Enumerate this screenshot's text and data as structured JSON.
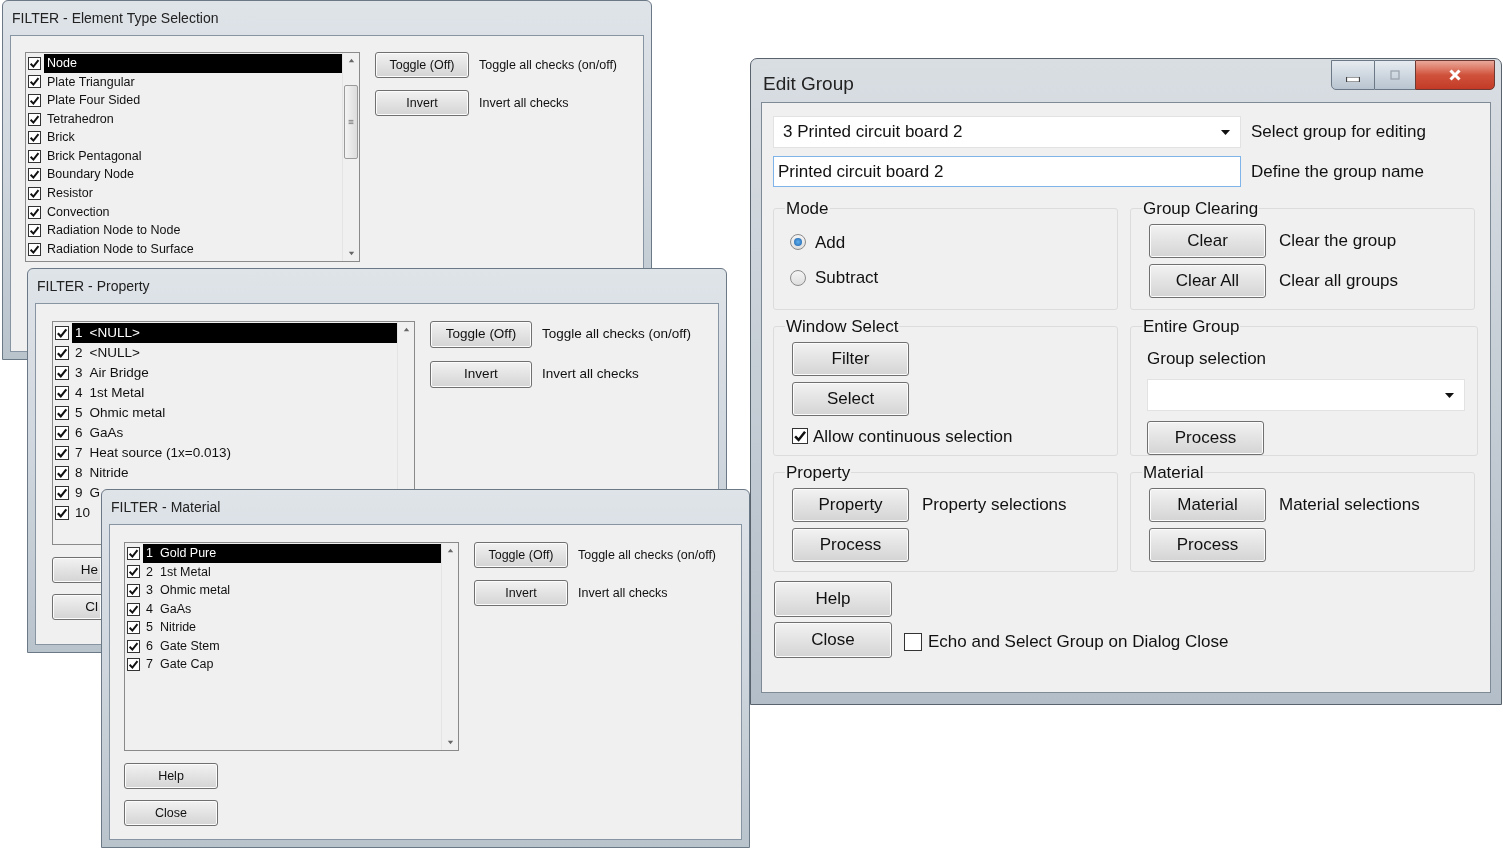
{
  "filter_windows": [
    {
      "title": "FILTER - Element Type Selection",
      "items": [
        {
          "label": "Node",
          "checked": true,
          "selected": true
        },
        {
          "label": "Plate Triangular",
          "checked": true,
          "selected": false
        },
        {
          "label": "Plate Four Sided",
          "checked": true,
          "selected": false
        },
        {
          "label": "Tetrahedron",
          "checked": true,
          "selected": false
        },
        {
          "label": "Brick",
          "checked": true,
          "selected": false
        },
        {
          "label": "Brick Pentagonal",
          "checked": true,
          "selected": false
        },
        {
          "label": "Boundary Node",
          "checked": true,
          "selected": false
        },
        {
          "label": "Resistor",
          "checked": true,
          "selected": false
        },
        {
          "label": "Convection",
          "checked": true,
          "selected": false
        },
        {
          "label": "Radiation Node to Node",
          "checked": true,
          "selected": false
        },
        {
          "label": "Radiation Node to Surface",
          "checked": true,
          "selected": false
        }
      ],
      "actions": [
        {
          "button": "Toggle (Off)",
          "description": "Toggle all checks (on/off)"
        },
        {
          "button": "Invert",
          "description": "Invert all checks"
        }
      ]
    },
    {
      "title": "FILTER - Property",
      "items": [
        {
          "number": "1",
          "label": "<NULL>",
          "checked": true,
          "selected": true
        },
        {
          "number": "2",
          "label": "<NULL>",
          "checked": true,
          "selected": false
        },
        {
          "number": "3",
          "label": "Air Bridge",
          "checked": true,
          "selected": false
        },
        {
          "number": "4",
          "label": "1st Metal",
          "checked": true,
          "selected": false
        },
        {
          "number": "5",
          "label": "Ohmic metal",
          "checked": true,
          "selected": false
        },
        {
          "number": "6",
          "label": "GaAs",
          "checked": true,
          "selected": false
        },
        {
          "number": "7",
          "label": "Heat source (1x=0.013)",
          "checked": true,
          "selected": false
        },
        {
          "number": "8",
          "label": "Nitride",
          "checked": true,
          "selected": false
        },
        {
          "number": "9",
          "label": "G",
          "checked": true,
          "selected": false
        },
        {
          "number": "10",
          "checked": true,
          "selected": false
        }
      ],
      "actions": [
        {
          "button": "Toggle (Off)",
          "description": "Toggle all checks (on/off)"
        },
        {
          "button": "Invert",
          "description": "Invert all checks"
        }
      ],
      "bottom_buttons": [
        "He",
        "Cl"
      ]
    },
    {
      "title": "FILTER - Material",
      "items": [
        {
          "number": "1",
          "label": "Gold Pure",
          "checked": true,
          "selected": true
        },
        {
          "number": "2",
          "label": "1st Metal",
          "checked": true,
          "selected": false
        },
        {
          "number": "3",
          "label": "Ohmic metal",
          "checked": true,
          "selected": false
        },
        {
          "number": "4",
          "label": "GaAs",
          "checked": true,
          "selected": false
        },
        {
          "number": "5",
          "label": "Nitride",
          "checked": true,
          "selected": false
        },
        {
          "number": "6",
          "label": "Gate Stem",
          "checked": true,
          "selected": false
        },
        {
          "number": "7",
          "label": "Gate Cap",
          "checked": true,
          "selected": false
        }
      ],
      "actions": [
        {
          "button": "Toggle (Off)",
          "description": "Toggle all checks (on/off)"
        },
        {
          "button": "Invert",
          "description": "Invert all checks"
        }
      ],
      "bottom_buttons": [
        "Help",
        "Close"
      ]
    }
  ],
  "edit_group": {
    "title": "Edit Group",
    "group_select": {
      "value": "3 Printed circuit board 2",
      "label": "Select group for editing"
    },
    "group_name": {
      "value": "Printed circuit board 2",
      "label": "Define the group name"
    },
    "mode": {
      "title": "Mode",
      "options": [
        {
          "label": "Add",
          "selected": true
        },
        {
          "label": "Subtract",
          "selected": false
        }
      ]
    },
    "group_clearing": {
      "title": "Group Clearing",
      "rows": [
        {
          "button": "Clear",
          "description": "Clear the group"
        },
        {
          "button": "Clear All",
          "description": "Clear all groups"
        }
      ]
    },
    "window_select": {
      "title": "Window Select",
      "buttons": [
        "Filter",
        "Select"
      ],
      "continuous": {
        "label": "Allow continuous selection",
        "checked": true
      }
    },
    "entire_group": {
      "title": "Entire Group",
      "label": "Group selection",
      "button": "Process"
    },
    "property": {
      "title": "Property",
      "button": "Property",
      "description": "Property selections",
      "process": "Process"
    },
    "material": {
      "title": "Material",
      "button": "Material",
      "description": "Material selections",
      "process": "Process"
    },
    "buttons": [
      "Help",
      "Close"
    ],
    "echo": {
      "label": "Echo and Select Group on Dialog Close",
      "checked": false
    }
  }
}
